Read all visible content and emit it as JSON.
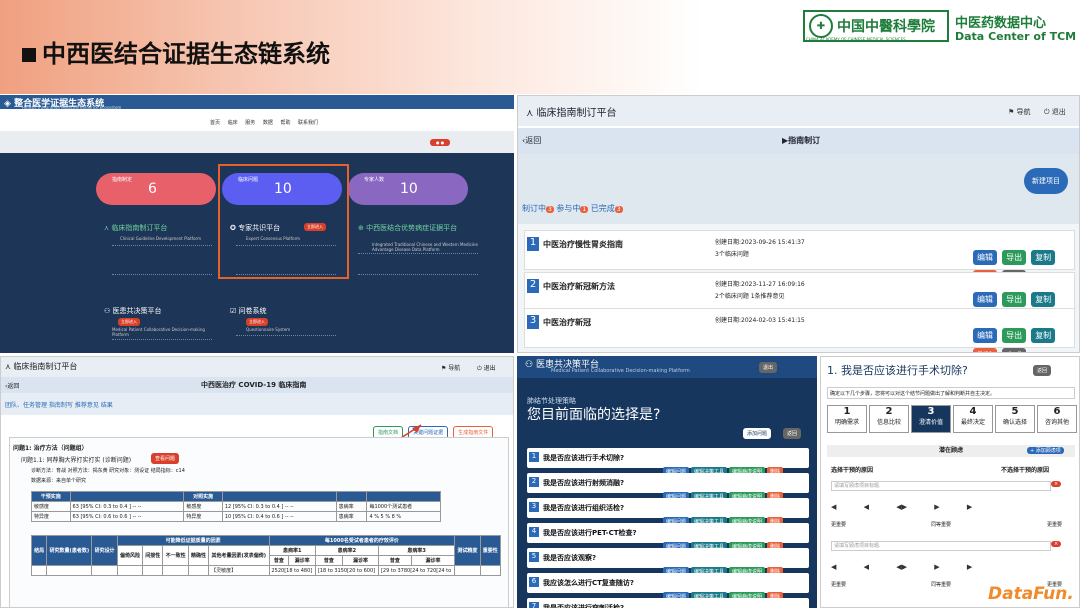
{
  "slide": {
    "title": "中西医结合证据生态链系统",
    "logo": {
      "name": "中国中醫科學院",
      "sub": "CHINA ACADEMY OF CHINESE MEDICAL SCIENCES",
      "dc_cn": "中医药数据中心",
      "dc_en": "Data Center of TCM"
    },
    "watermark": "DataFun."
  },
  "p1": {
    "title": "整合医学证据生态系统",
    "subtitle": "Holistic Integrative Medicine Evidence Ecosystem",
    "nav": [
      "首页",
      "临床",
      "服务",
      "数据",
      "帮助",
      "联系我们"
    ],
    "stat1_label": "指南制定",
    "stat1_value": "6",
    "stat2_label": "临床问题",
    "stat2_value": "10",
    "stat3_label": "专家人数",
    "stat3_value": "10",
    "card1_title": "临床指南制订平台",
    "card1_en": "Clinical Guideline Development Platform",
    "card2_title": "专家共识平台",
    "card2_en": "Expert Consensus Platform",
    "card2_badge": "立即进入",
    "card3_title": "中西医结合优势病症证据平台",
    "card3_en": "Integrated Traditional Chinese and Western Medicine Advantage Disease Data Platform",
    "card4_title": "医患共决策平台",
    "card4_en": "Medical Patient Collaborative Decision-making Platform",
    "card4_badge": "立即进入",
    "card5_title": "问卷系统",
    "card5_en": "Questionnaire System",
    "card5_badge": "立即进入"
  },
  "p2": {
    "header": "临床指南制订平台",
    "nav_home": "导航",
    "nav_exit": "退出",
    "back": "返回",
    "crumb": "指南制订",
    "new_btn": "新建项目",
    "tabs": [
      "制订中",
      "3",
      "参与中",
      "1",
      "已完成",
      "3"
    ],
    "rows": [
      {
        "num": "1",
        "name": "中医治疗慢性胃炎指南",
        "date": "创建日期:2023-09-26 15:41:37",
        "count": "3个临床问题"
      },
      {
        "num": "2",
        "name": "中医治疗新冠新方法",
        "date": "创建日期:2023-11-27 16:09:16",
        "count": "2个临床问题  1条推荐意见"
      },
      {
        "num": "3",
        "name": "中医治疗新冠",
        "date": "创建日期:2024-02-03 15:41:15",
        "count": ""
      }
    ],
    "row_btns": [
      "编辑",
      "导出",
      "复制",
      "删除",
      "完成"
    ]
  },
  "p3": {
    "header": "临床指南制订平台",
    "nav_home": "导航",
    "nav_exit": "退出",
    "back": "返回",
    "title": "中西医治疗 COVID-19 临床指南",
    "crumbs": "团队、任务管理  指南制写  推荐意见  结果",
    "btns": [
      "指南文档",
      "关键问题证据",
      "生成指南文件"
    ],
    "q1": "问题1: 治疗方法（问题组）",
    "q11": "问题1.1: 同荐胸大界打实打实 (诊断问题)",
    "q11_btn": "查看问题",
    "line1": "诊断方法：育战      对照方法：揭东黄      研究对象：测设证      结局指标：c14",
    "line2": "数据来源：来自单个研究",
    "t1_head": [
      "干预实施",
      "",
      "对照实施",
      "",
      "",
      ""
    ],
    "t1_rows": [
      [
        "敏感度",
        "63 [95% CI: 0.3 to 0.4 ] -- --",
        "敏感度",
        "12 [95% CI: 0.3 to 0.4 ] -- --",
        "患病率",
        "每1000个测试患者"
      ],
      [
        "特异度",
        "63 [95% CI: 0.6 to 0.6 ] -- --",
        "特异度",
        "10 [95% CI: 0.4 to 0.6 ] -- --",
        "患病率",
        "4 % 5 % 8 %"
      ]
    ],
    "t2_h1": [
      "结局",
      "研究数量(患者数)",
      "研究设计",
      "可能降低证据质量的因素",
      "每1000名受试者患者的疗效评价",
      "测试精度",
      "重要性"
    ],
    "t2_h2": [
      "偏倚风险",
      "间接性",
      "不一致性",
      "精确性",
      "其他考量因素(发表偏倚)",
      "患病率1",
      "患病率2",
      "患病率3"
    ],
    "t2_h3": [
      "普查",
      "漏诊率",
      "普查",
      "漏诊率",
      "普查",
      "漏诊率"
    ],
    "t2_row": [
      "【灵敏度】",
      "2520[18 to 480]",
      "[18 to 3150[20 to 600]",
      "[29 to 3780[24 to 720[24 to"
    ]
  },
  "p4": {
    "title": "医患共决策平台",
    "en": "Medical Patient Collaborative Decision-making Platform",
    "exit": "退出",
    "label": "肺结节处理策略",
    "heading": "您目前面临的选择是?",
    "btn_q": "添加问题",
    "btn_back": "返回",
    "questions": [
      "我是否应该进行手术切除?",
      "我是否应该进行射频消融?",
      "我是否应该进行组织活检?",
      "我是否应该进行PET-CT检查?",
      "我是否应该观察?",
      "我应该怎么进行CT复查随访?",
      "我是否应该进行穿刺活检?"
    ],
    "q_btns": [
      "编辑问题",
      "编辑决策工具",
      "编辑病虚说明",
      "删除"
    ]
  },
  "p5": {
    "title": "1. 我是否应该进行手术切除?",
    "back": "返回",
    "desc": "确定以下几个步骤，您将可以对这个结节问题做出了解和判断并自主决定。",
    "steps": [
      {
        "n": "1",
        "t": "明确需求"
      },
      {
        "n": "2",
        "t": "信息比较"
      },
      {
        "n": "3",
        "t": "澄清价值"
      },
      {
        "n": "4",
        "t": "最终决定"
      },
      {
        "n": "5",
        "t": "确认选择"
      },
      {
        "n": "6",
        "t": "咨询其他"
      }
    ],
    "section": "潜在顾虑",
    "add": "+ 添加顾虑项",
    "col_left": "选择干预的原因",
    "col_right": "不选择干预的原因",
    "ph": "请填写顾虑项目标题.",
    "imp_left": "更重要",
    "imp_mid": "同等重要",
    "imp_right": "更重要"
  }
}
